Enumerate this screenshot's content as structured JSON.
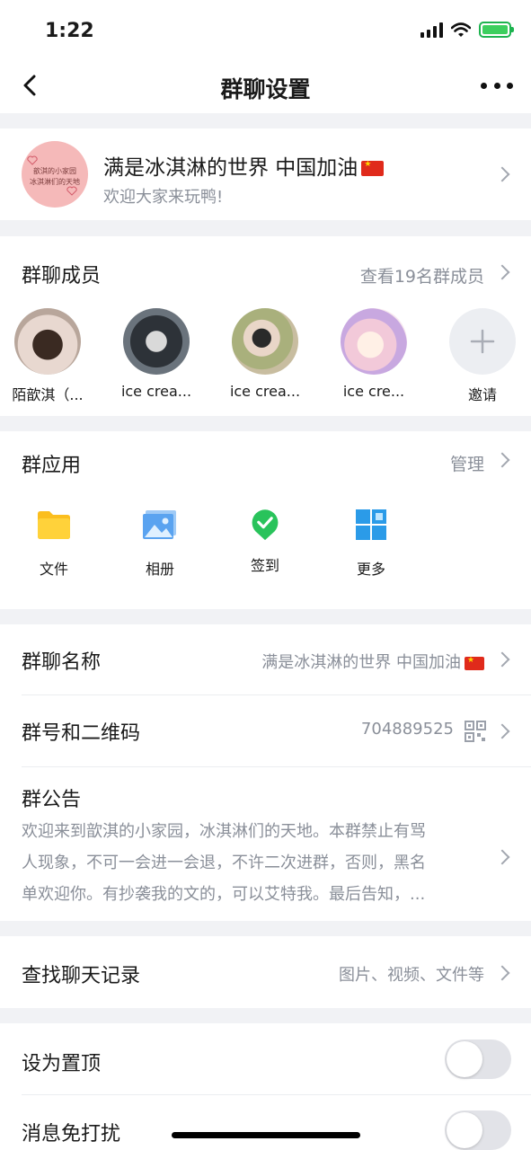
{
  "status_bar": {
    "time": "1:22"
  },
  "nav": {
    "title": "群聊设置"
  },
  "group": {
    "avatar_line1": "歆淇的小家园",
    "avatar_line2": "冰淇淋们的天地",
    "name": "满是冰淇淋的世界  中国加油",
    "subtitle": "欢迎大家来玩鸭!"
  },
  "members": {
    "title": "群聊成员",
    "view_all": "查看19名群成员",
    "list": [
      {
        "name": "陌歆淇（...",
        "color": "#c9a99a"
      },
      {
        "name": "ice crea...",
        "color": "#5e6670"
      },
      {
        "name": "ice crea...",
        "color": "#a7a07a"
      },
      {
        "name": "ice   cre...",
        "color": "#e8c8d8"
      }
    ],
    "invite_label": "邀请"
  },
  "apps": {
    "title": "群应用",
    "manage": "管理",
    "items": [
      {
        "label": "文件",
        "icon": "folder-icon"
      },
      {
        "label": "相册",
        "icon": "photo-album-icon"
      },
      {
        "label": "签到",
        "icon": "check-in-icon"
      },
      {
        "label": "更多",
        "icon": "grid-more-icon"
      }
    ]
  },
  "settings": {
    "group_name_label": "群聊名称",
    "group_name_value": "满是冰淇淋的世界  中国加油",
    "group_number_label": "群号和二维码",
    "group_number_value": "704889525",
    "announcement_label": "群公告",
    "announcement_line1": "欢迎来到歆淇的小家园，冰淇淋们的天地。本群禁止有骂",
    "announcement_line2": "人现象，不可一会进一会退，不许二次进群，否则，黑名",
    "announcement_line3": "单欢迎你。有抄袭我的文的，可以艾特我。最后告知，...",
    "search_label": "查找聊天记录",
    "search_value": "图片、视频、文件等",
    "pin_label": "设为置顶",
    "mute_label": "消息免打扰"
  },
  "colors": {
    "accent_green": "#29c35b",
    "folder_yellow": "#fbbe1e",
    "photo_blue": "#5aa3f0",
    "grid_blue": "#2b9be8"
  }
}
